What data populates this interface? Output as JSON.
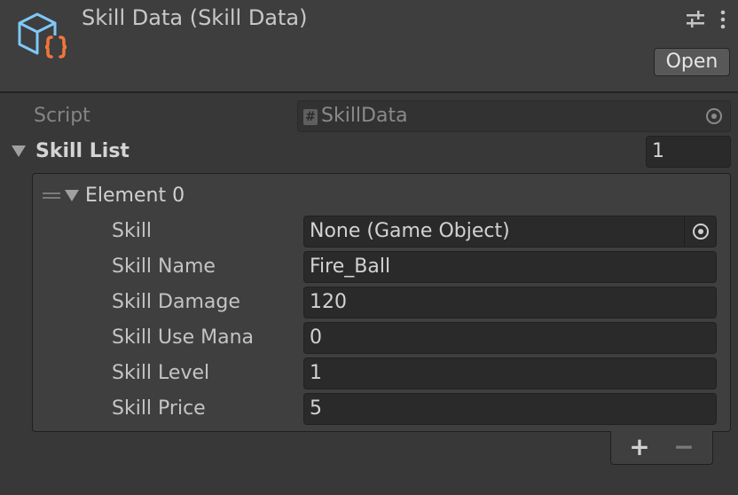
{
  "header": {
    "title": "Skill Data (Skill Data)",
    "open_label": "Open",
    "icon": "scriptable-object-icon",
    "icon_colors": {
      "cube": "#7fc8f8",
      "braces": "#f0763c"
    }
  },
  "script_row": {
    "label": "Script",
    "value": "SkillData",
    "hash_glyph": "#"
  },
  "skill_list": {
    "label": "Skill List",
    "size": "1",
    "element": {
      "label": "Element 0",
      "fields": [
        {
          "label": "Skill",
          "value": "None (Game Object)"
        },
        {
          "label": "Skill Name",
          "value": "Fire_Ball"
        },
        {
          "label": "Skill Damage",
          "value": "120"
        },
        {
          "label": "Skill Use Mana",
          "value": "0"
        },
        {
          "label": "Skill Level",
          "value": "1"
        },
        {
          "label": "Skill Price",
          "value": "5"
        }
      ]
    },
    "add_glyph": "+",
    "remove_glyph": "−"
  }
}
